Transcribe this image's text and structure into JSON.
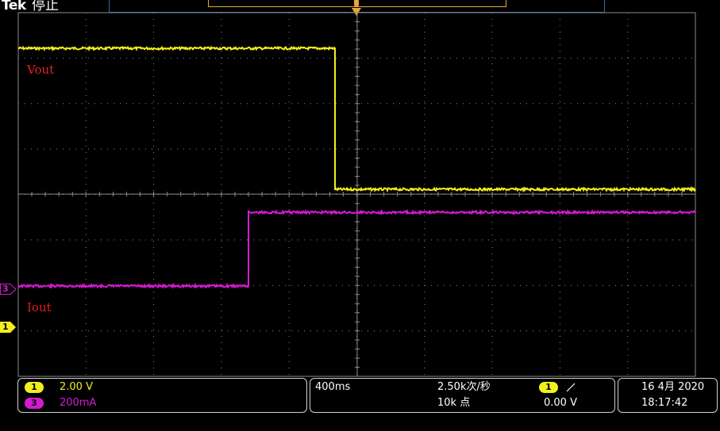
{
  "header": {
    "brand": "Tek",
    "run_state": "停止"
  },
  "colors": {
    "ch1": "#f3ef1d",
    "ch3": "#d51ad0",
    "graticule": "#8a8a8a",
    "trigger": "#e8a63a",
    "label_red": "#e02020",
    "frame_blue": "#2a6fb0"
  },
  "trigger": {
    "marker_icon": "trigger-position-icon",
    "level_icon": "rising-edge-icon"
  },
  "traces": {
    "ch1_label": "Vout",
    "ch3_label": "Iout"
  },
  "channel_markers": {
    "ch1": "1",
    "ch3": "3"
  },
  "status": {
    "ch1_badge": "1",
    "ch1_scale": "2.00 V",
    "ch3_badge": "3",
    "ch3_scale": "200mA",
    "timebase": "400ms",
    "sample_rate": "2.50k次/秒",
    "record_length": "10k 点",
    "trig_badge": "1",
    "trig_level": "0.00 V",
    "date": "16 4月 2020",
    "time": "18:17:42"
  }
}
